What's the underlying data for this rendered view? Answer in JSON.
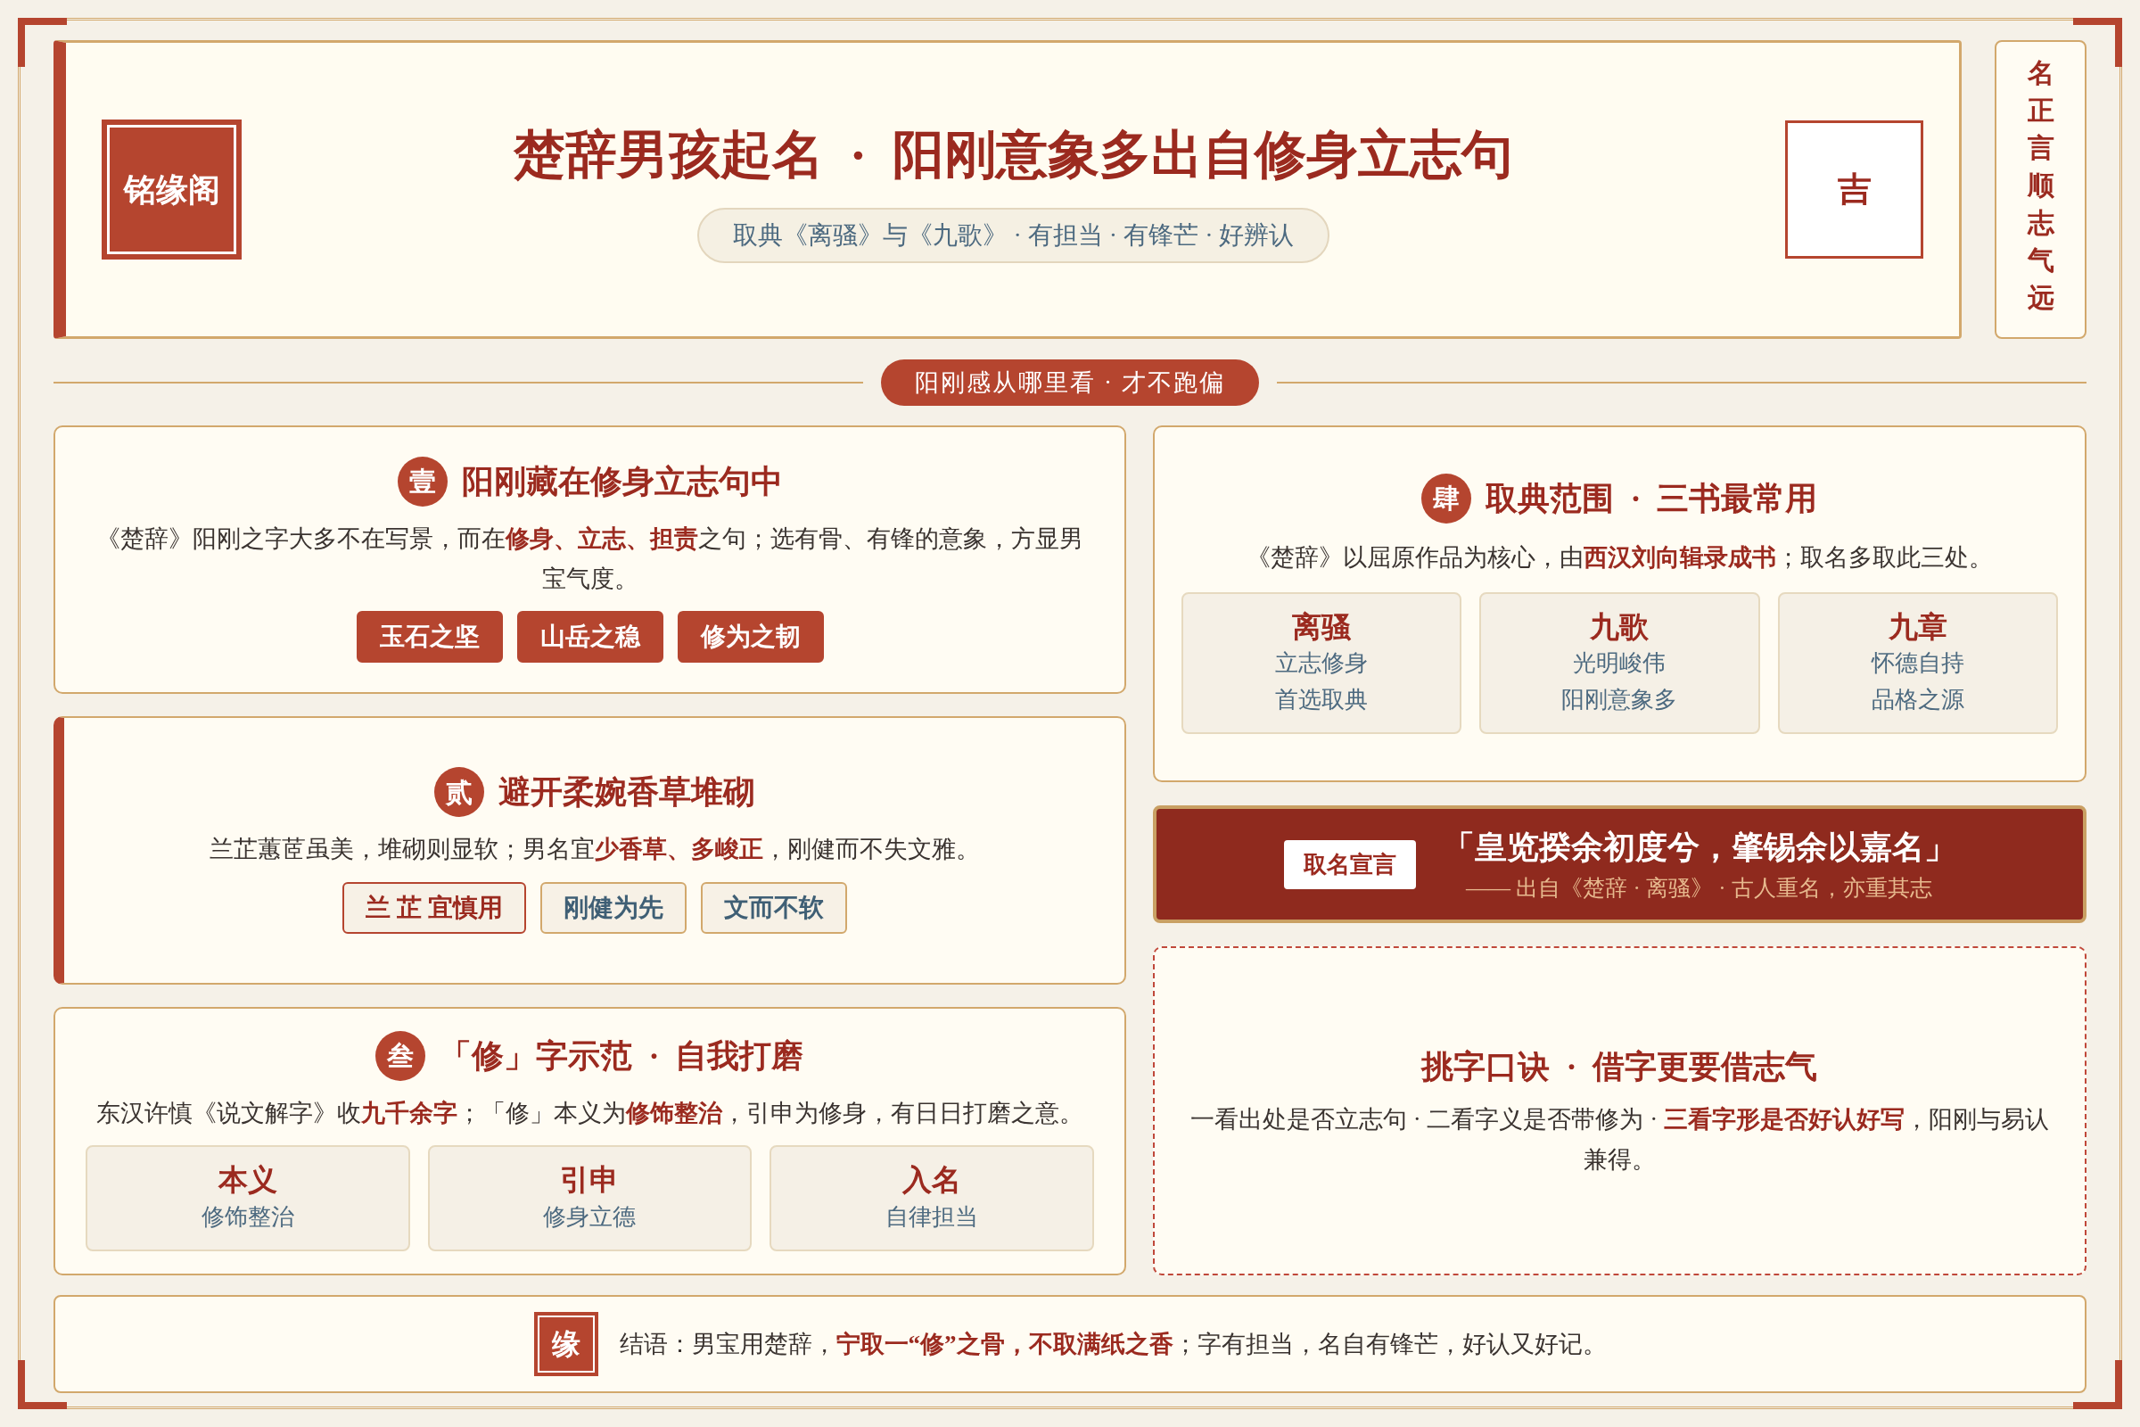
{
  "header": {
    "logo": "铭缘阁",
    "title": "楚辞男孩起名  ·  阳刚意象多出自修身立志句",
    "subtitle": "取典《离骚》与《九歌》 · 有担当 · 有锋芒 · 好辨认",
    "seal": "吉"
  },
  "side_motto": "名正言顺志气远",
  "divider": "阳刚感从哪里看 · 才不跑偏",
  "left_cards": [
    {
      "kind": "tags",
      "accent_bar": false,
      "badge": "壹",
      "title": "阳刚藏在修身立志句中",
      "text": "《楚辞》阳刚之字大多不在写景，而在**修身、立志、担责**之句；选有骨、有锋的意象，方显男宝气度。",
      "tags": [
        {
          "kind": "solid",
          "label": "玉石之坚"
        },
        {
          "kind": "solid",
          "label": "山岳之稳"
        },
        {
          "kind": "solid",
          "label": "修为之韧"
        }
      ]
    },
    {
      "kind": "tags",
      "accent_bar": true,
      "badge": "贰",
      "title": "避开柔婉香草堆砌",
      "text": "兰芷蕙茝虽美，堆砌则显软；男名宜**少香草、多峻正**，刚健而不失文雅。",
      "tags": [
        {
          "kind": "warn",
          "label": "兰 芷 宜慎用"
        },
        {
          "kind": "outline",
          "label": "刚健为先"
        },
        {
          "kind": "outline",
          "label": "文而不软"
        }
      ]
    },
    {
      "kind": "terms",
      "accent_bar": false,
      "badge": "叁",
      "title": "「修」字示范  ·  自我打磨",
      "text": "东汉许慎《说文解字》收**九千余字**；「修」本义为**修饰整治**，引申为修身，有日日打磨之意。",
      "items": [
        {
          "head": "本义",
          "lines": [
            "修饰整治"
          ]
        },
        {
          "head": "引申",
          "lines": [
            "修身立德"
          ]
        },
        {
          "head": "入名",
          "lines": [
            "自律担当"
          ]
        }
      ]
    }
  ],
  "canon_card": {
    "badge": "肆",
    "title": "取典范围  ·  三书最常用",
    "text": "《楚辞》以屈原作品为核心，由**西汉刘向辑录成书**；取名多取此三处。",
    "items": [
      {
        "head": "离骚",
        "lines": [
          "立志修身",
          "首选取典"
        ]
      },
      {
        "head": "九歌",
        "lines": [
          "光明峻伟",
          "阳刚意象多"
        ]
      },
      {
        "head": "九章",
        "lines": [
          "怀德自持",
          "品格之源"
        ]
      }
    ]
  },
  "quote_band": {
    "label": "取名宣言",
    "quote": "「皇览揆余初度兮，肇锡余以嘉名」",
    "source": "—— 出自《楚辞 · 离骚》 · 古人重名，亦重其志"
  },
  "tips_card": {
    "title": "挑字口诀  ·  借字更要借志气",
    "text": "一看出处是否立志句 · 二看字义是否带修为 · **三看字形是否好认好写**，阳刚与易认兼得。"
  },
  "footer": {
    "seal": "缘",
    "text": "结语：男宝用楚辞，**宁取一“修”之骨，不取满纸之香**；字有担当，名自有锋芒，好认又好记。"
  }
}
